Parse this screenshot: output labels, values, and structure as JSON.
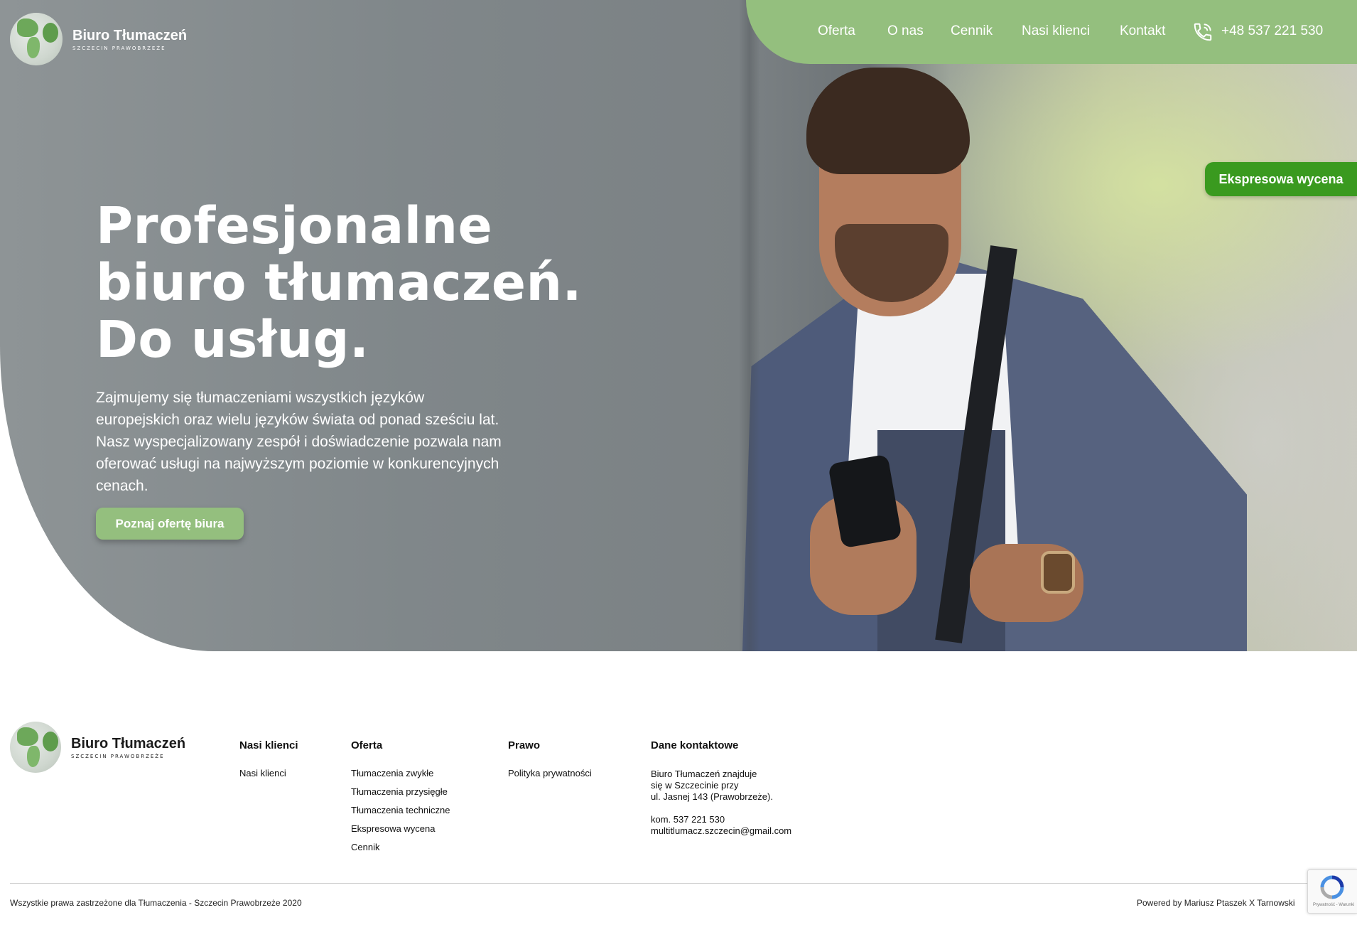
{
  "brand": {
    "title": "Biuro Tłumaczeń",
    "subtitle": "SZCZECIN PRAWOBRZEŻE"
  },
  "nav": {
    "items": [
      "Oferta",
      "O nas",
      "Cennik",
      "Nasi klienci",
      "Kontakt"
    ],
    "phone": "+48 537 221 530"
  },
  "express_button": "Ekspresowa wycena",
  "hero": {
    "title_lines": [
      "Profesjonalne",
      "biuro tłumaczeń.",
      "Do usług."
    ],
    "description": "Zajmujemy się tłumaczeniami wszystkich języków europejskich oraz wielu języków świata od ponad sześciu lat. Nasz wyspecjalizowany zespół i doświadczenie pozwala nam oferować usługi na najwyższym poziomie w konkurencyjnych cenach.",
    "cta": "Poznaj ofertę biura"
  },
  "footer": {
    "clients": {
      "heading": "Nasi klienci",
      "links": [
        "Nasi klienci"
      ]
    },
    "offer": {
      "heading": "Oferta",
      "links": [
        "Tłumaczenia zwykłe",
        "Tłumaczenia przysięgłe",
        "Tłumaczenia techniczne",
        "Ekspresowa wycena",
        "Cennik"
      ]
    },
    "law": {
      "heading": "Prawo",
      "links": [
        "Polityka prywatności"
      ]
    },
    "contact": {
      "heading": "Dane kontaktowe",
      "address_lines": [
        "Biuro Tłumaczeń znajduje",
        "się w Szczecinie przy",
        "ul. Jasnej 143 (Prawobrzeże)."
      ],
      "phone": "kom. 537 221 530",
      "email": "multitlumacz.szczecin@gmail.com"
    },
    "copyright": "Wszystkie prawa zastrzeżone dla Tłumaczenia - Szczecin Prawobrzeże 2020",
    "powered": "Powered by Mariusz Ptaszek X Tarnowski",
    "recaptcha_text": "Prywatność - Warunki"
  },
  "colors": {
    "accent": "#94bf7e",
    "express": "#3a9a1f"
  }
}
